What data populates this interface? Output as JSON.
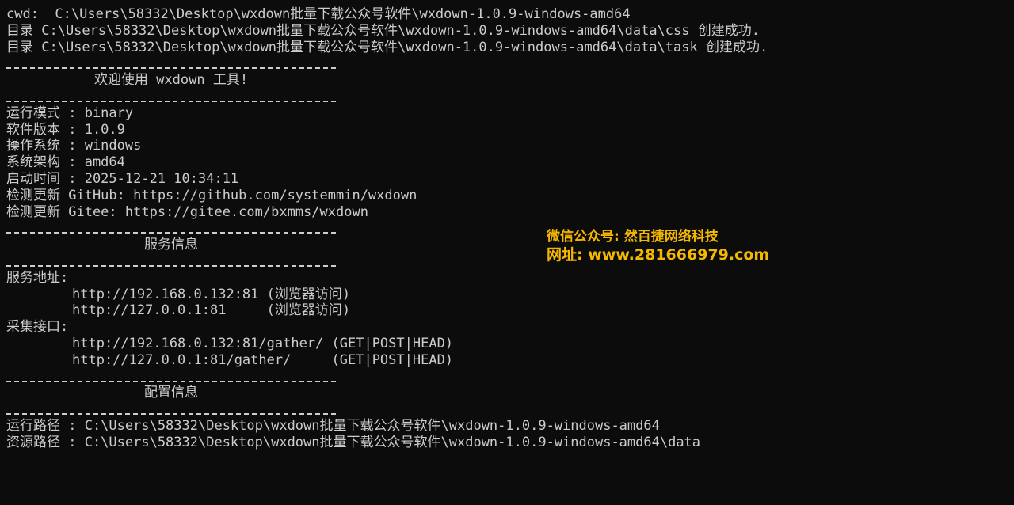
{
  "terminal": {
    "cwd": "cwd:  C:\\Users\\58332\\Desktop\\wxdown批量下载公众号软件\\wxdown-1.0.9-windows-amd64",
    "dir_css": "目录 C:\\Users\\58332\\Desktop\\wxdown批量下载公众号软件\\wxdown-1.0.9-windows-amd64\\data\\css 创建成功.",
    "dir_task": "目录 C:\\Users\\58332\\Desktop\\wxdown批量下载公众号软件\\wxdown-1.0.9-windows-amd64\\data\\task 创建成功.",
    "welcome": "欢迎使用 wxdown 工具!",
    "run_mode": "运行模式 : binary",
    "version": "软件版本 : 1.0.9",
    "os": "操作系统 : windows",
    "arch": "系统架构 : amd64",
    "start_time": "启动时间 : 2025-12-21 10:34:11",
    "update_github": "检测更新 GitHub: https://github.com/systemmin/wxdown",
    "update_gitee": "检测更新 Gitee: https://gitee.com/bxmms/wxdown",
    "service_header": "服务信息",
    "service_addr_label": "服务地址:",
    "service_addr_1": "http://192.168.0.132:81 (浏览器访问)",
    "service_addr_2": "http://127.0.0.1:81     (浏览器访问)",
    "gather_label": "采集接口:",
    "gather_1": "http://192.168.0.132:81/gather/ (GET|POST|HEAD)",
    "gather_2": "http://127.0.0.1:81/gather/     (GET|POST|HEAD)",
    "config_header": "配置信息",
    "run_path": "运行路径 : C:\\Users\\58332\\Desktop\\wxdown批量下载公众号软件\\wxdown-1.0.9-windows-amd64",
    "res_path": "资源路径 : C:\\Users\\58332\\Desktop\\wxdown批量下载公众号软件\\wxdown-1.0.9-windows-amd64\\data"
  },
  "watermark": {
    "line1": "微信公众号: 然百捷网络科技",
    "line2": "网址: www.281666979.com"
  },
  "colors": {
    "background": "#0c0c0c",
    "text": "#cccccc",
    "watermark": "#f5b800"
  }
}
